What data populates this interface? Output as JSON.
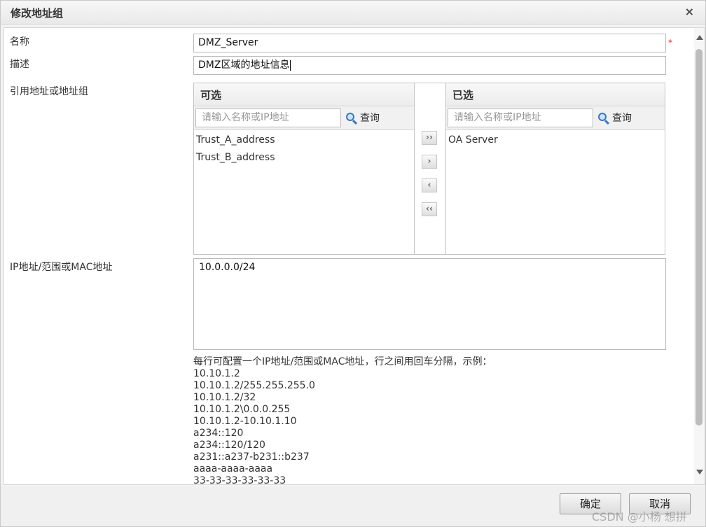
{
  "dialog": {
    "title": "修改地址组",
    "close_glyph": "×"
  },
  "form": {
    "name_label": "名称",
    "name_value": "DMZ_Server",
    "required_mark": "*",
    "desc_label": "描述",
    "desc_value": "DMZ区域的地址信息",
    "ref_label": "引用地址或地址组",
    "ip_label": "IP地址/范围或MAC地址",
    "ip_value": "10.0.0.0/24"
  },
  "picker": {
    "available": {
      "title": "可选",
      "search_placeholder": "请输入名称或IP地址",
      "query_label": "查询",
      "items": [
        "Trust_A_address",
        "Trust_B_address"
      ]
    },
    "selected": {
      "title": "已选",
      "search_placeholder": "请输入名称或IP地址",
      "query_label": "查询",
      "items": [
        "OA Server"
      ]
    },
    "move_buttons": {
      "add_all": "››",
      "add": "›",
      "remove": "‹",
      "remove_all": "‹‹"
    }
  },
  "hint": {
    "intro": "每行可配置一个IP地址/范围或MAC地址，行之间用回车分隔，示例：",
    "examples": [
      "10.10.1.2",
      "10.10.1.2/255.255.255.0",
      "10.10.1.2/32",
      "10.10.1.2\\0.0.0.255",
      "10.10.1.2-10.10.1.10",
      "a234::120",
      "a234::120/120",
      "a231::a237-b231::b237",
      "aaaa-aaaa-aaaa",
      "33-33-33-33-33-33"
    ]
  },
  "footer": {
    "ok_label": "确定",
    "cancel_label": "取消"
  },
  "watermark": "CSDN @小杨 想拼",
  "icons": {
    "search": "search-icon",
    "close": "close-icon"
  },
  "colors": {
    "required": "#e0301e",
    "search_icon": "#3a76c5"
  }
}
